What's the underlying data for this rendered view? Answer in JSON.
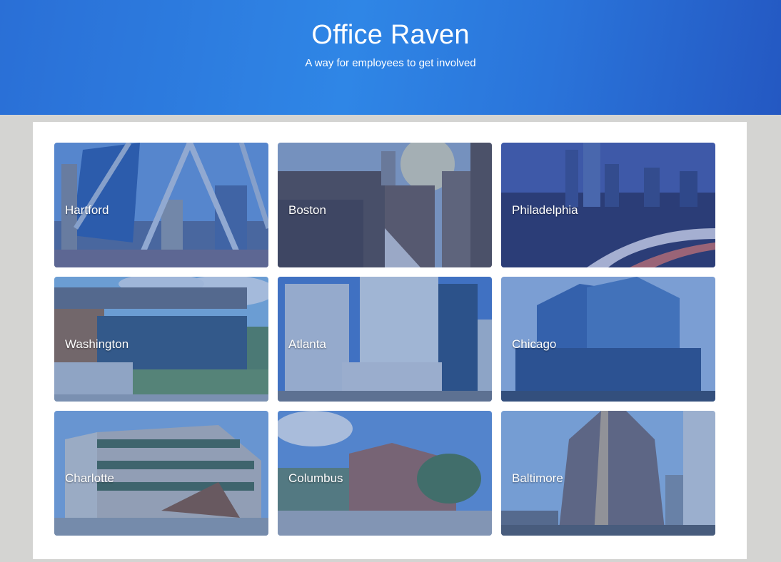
{
  "header": {
    "title": "Office Raven",
    "subtitle": "A way for employees to get involved"
  },
  "colors": {
    "header_blue": "#2f86e6",
    "panel_bg": "#ffffff",
    "page_bg": "#d4d4d2"
  },
  "offices": [
    {
      "name": "Hartford",
      "photo": "city-bridge-photo"
    },
    {
      "name": "Boston",
      "photo": "city-sunset-photo"
    },
    {
      "name": "Philadelphia",
      "photo": "city-skyline-night-photo"
    },
    {
      "name": "Washington",
      "photo": "office-building-photo"
    },
    {
      "name": "Atlanta",
      "photo": "office-towers-photo"
    },
    {
      "name": "Chicago",
      "photo": "glass-tower-photo"
    },
    {
      "name": "Charlotte",
      "photo": "office-building-photo"
    },
    {
      "name": "Columbus",
      "photo": "brick-building-photo"
    },
    {
      "name": "Baltimore",
      "photo": "skyscraper-photo"
    }
  ]
}
